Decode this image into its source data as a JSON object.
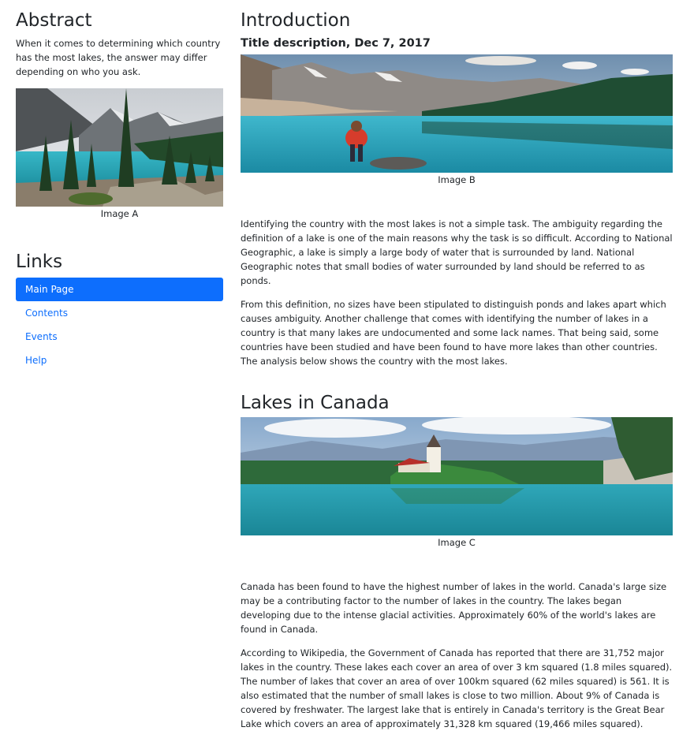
{
  "sidebar": {
    "abstract_title": "Abstract",
    "abstract_text": "When it comes to determining which country has the most lakes, the answer may differ depending on who you ask.",
    "image_a_caption": "Image A",
    "links_title": "Links",
    "links": [
      {
        "label": "Main Page",
        "active": true
      },
      {
        "label": "Contents",
        "active": false
      },
      {
        "label": "Events",
        "active": false
      },
      {
        "label": "Help",
        "active": false
      }
    ]
  },
  "main": {
    "intro_title": "Introduction",
    "intro_subtitle": "Title description, Dec 7, 2017",
    "image_b_caption": "Image B",
    "intro_paragraphs": [
      "Identifying the country with the most lakes is not a simple task. The ambiguity regarding the definition of a lake is one of the main reasons why the task is so difficult. According to National Geographic, a lake is simply a large body of water that is surrounded by land. National Geographic notes that small bodies of water surrounded by land should be referred to as ponds.",
      "From this definition, no sizes have been stipulated to distinguish ponds and lakes apart which causes ambiguity. Another challenge that comes with identifying the number of lakes in a country is that many lakes are undocumented and some lack names. That being said, some countries have been studied and have been found to have more lakes than other countries. The analysis below shows the country with the most lakes."
    ],
    "canada_title": "Lakes in Canada",
    "image_c_caption": "Image C",
    "canada_paragraphs": [
      "Canada has been found to have the highest number of lakes in the world. Canada's large size may be a contributing factor to the number of lakes in the country. The lakes began developing due to the intense glacial activities. Approximately 60% of the world's lakes are found in Canada.",
      "According to Wikipedia, the Government of Canada has reported that there are 31,752 major lakes in the country. These lakes each cover an area of over 3 km squared (1.8 miles squared). The number of lakes that cover an area of over 100km squared (62 miles squared) is 561. It is also estimated that the number of small lakes is close to two million. About 9% of Canada is covered by freshwater. The largest lake that is entirely in Canada's territory is the Great Bear Lake which covers an area of approximately 31,328 km squared (19,466 miles squared)."
    ]
  },
  "colors": {
    "accent": "#0d6efd",
    "text": "#212529"
  }
}
